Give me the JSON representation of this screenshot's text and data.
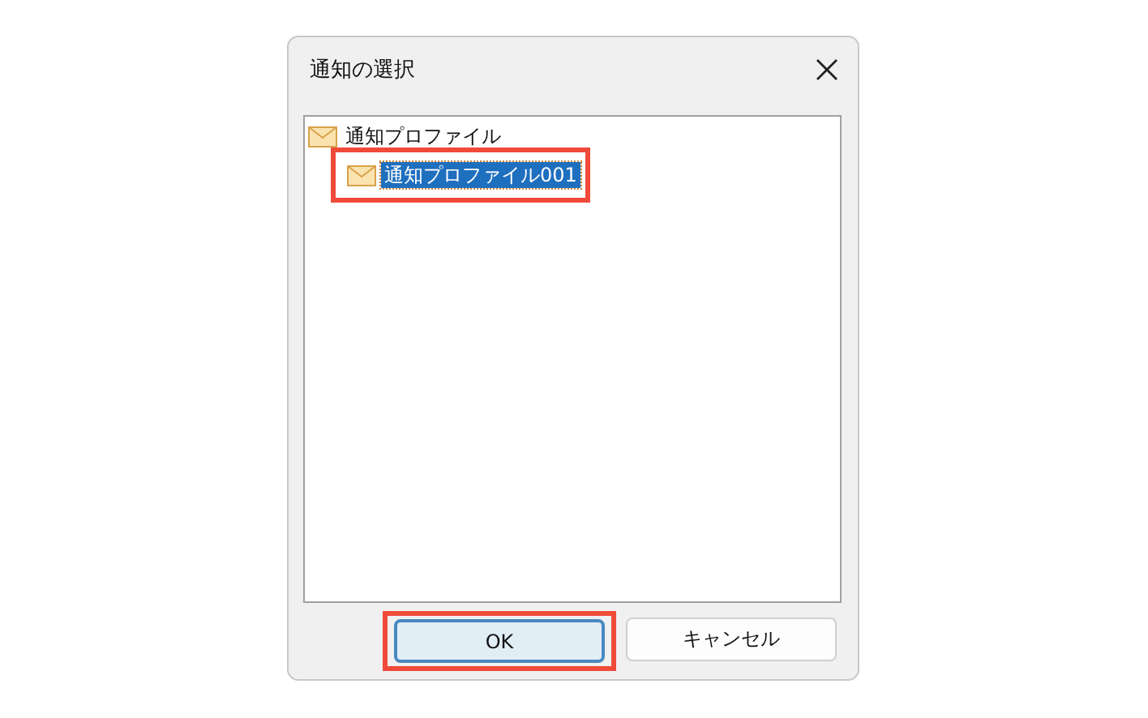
{
  "window": {
    "title": "通知の選択"
  },
  "tree": {
    "items": [
      {
        "label": "通知プロファイル",
        "selected": false,
        "highlighted": false,
        "children": [
          {
            "label": "通知プロファイル001",
            "selected": true,
            "highlighted": true
          }
        ]
      }
    ]
  },
  "buttons": [
    {
      "label": "OK",
      "default": true,
      "highlighted": true
    },
    {
      "label": "キャンセル",
      "default": false,
      "highlighted": false
    }
  ]
}
